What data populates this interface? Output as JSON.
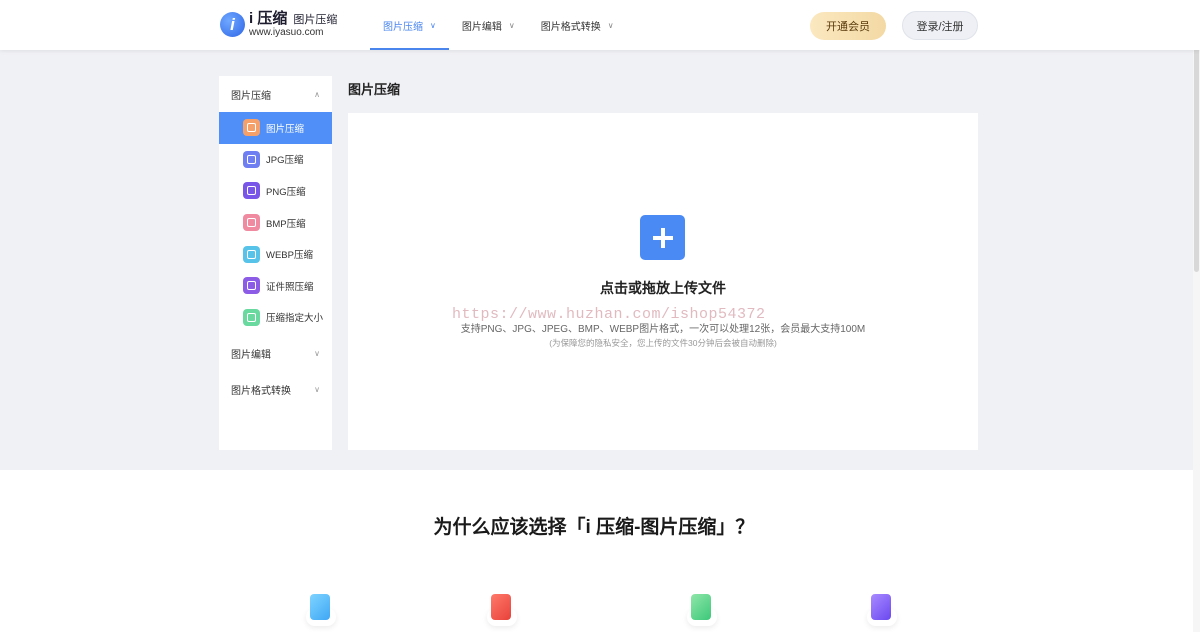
{
  "header": {
    "logo_mark": "i",
    "brand": "i 压缩",
    "subtitle": "图片压缩",
    "url": "www.iyasuo.com",
    "nav": [
      {
        "label": "图片压缩",
        "active": true
      },
      {
        "label": "图片编辑",
        "active": false
      },
      {
        "label": "图片格式转换",
        "active": false
      }
    ],
    "vip_label": "开通会员",
    "login_label": "登录/注册"
  },
  "sidebar": {
    "group_compress": "图片压缩",
    "items": [
      {
        "label": "图片压缩",
        "icon": "image-compress-icon",
        "color": "#f5a06a"
      },
      {
        "label": "JPG压缩",
        "icon": "jpg-icon",
        "color": "#6f7ff2"
      },
      {
        "label": "PNG压缩",
        "icon": "png-icon",
        "color": "#7a56e8"
      },
      {
        "label": "BMP压缩",
        "icon": "bmp-icon",
        "color": "#f08aa0"
      },
      {
        "label": "WEBP压缩",
        "icon": "webp-icon",
        "color": "#58c3e8"
      },
      {
        "label": "证件照压缩",
        "icon": "id-photo-icon",
        "color": "#8c5ce6"
      },
      {
        "label": "压缩指定大小",
        "icon": "size-icon",
        "color": "#6ad9a0"
      }
    ],
    "group_edit": "图片编辑",
    "group_convert": "图片格式转换"
  },
  "main": {
    "title": "图片压缩",
    "upload_title": "点击或拖放上传文件",
    "upload_desc": "支持PNG、JPG、JPEG、BMP、WEBP图片格式，一次可以处理12张，会员最大支持100M",
    "upload_note": "(为保障您的隐私安全，您上传的文件30分钟后会被自动删除)"
  },
  "watermark": "https://www.huzhan.com/ishop54372",
  "why": {
    "title": "为什么应该选择「i 压缩-图片压缩」？"
  },
  "colors": {
    "accent": "#4a8af4",
    "band": "#f0f1f5"
  }
}
